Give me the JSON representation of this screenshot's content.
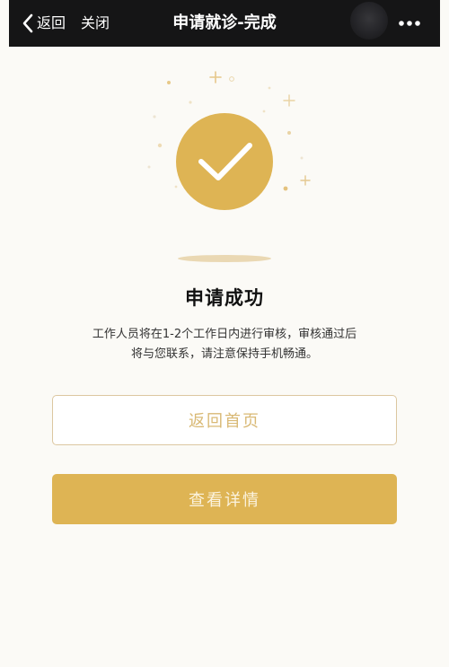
{
  "nav": {
    "back_label": "返回",
    "close_label": "关闭",
    "title": "申请就诊-完成",
    "more_icon": "more-dots-icon",
    "back_icon": "chevron-left-icon"
  },
  "result": {
    "icon": "success-check-icon",
    "title": "申请成功",
    "description_line1": "工作人员将在1-2个工作日内进行审核，审核通过后",
    "description_line2": "将与您联系，请注意保持手机畅通。"
  },
  "actions": {
    "home_label": "返回首页",
    "detail_label": "查看详情"
  },
  "colors": {
    "accent": "#deb454",
    "nav_bg": "#151516",
    "page_bg": "#fbfaf6",
    "outline_text": "#d9b975"
  }
}
